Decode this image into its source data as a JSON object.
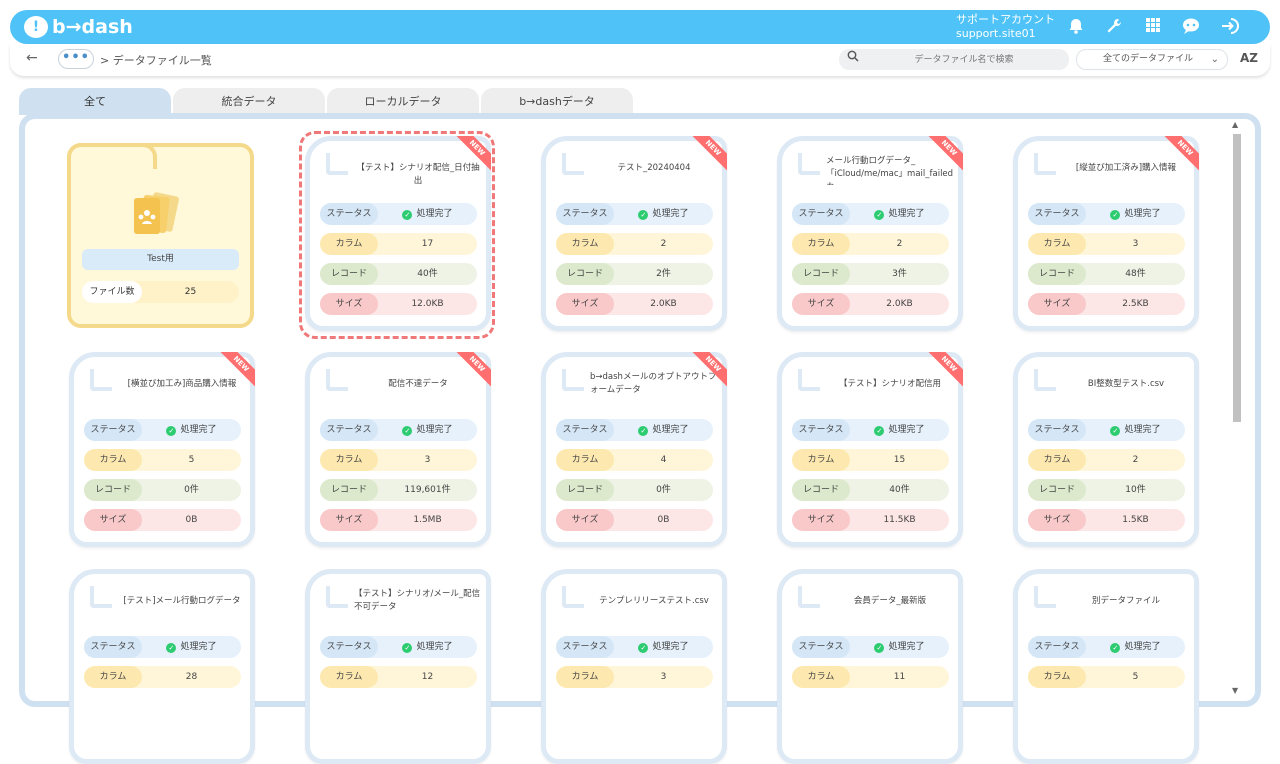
{
  "header": {
    "logo_text": "b→dash",
    "account_line1": "サポートアカウント",
    "account_line2": "support.site01",
    "icons": [
      "bell-icon",
      "wrench-icon",
      "grid-icon",
      "chat-bot-icon",
      "logout-icon"
    ]
  },
  "subbar": {
    "back": "←",
    "more": "•••",
    "breadcrumb": "> データファイル一覧",
    "search_placeholder": "データファイル名で検索",
    "filter_value": "全てのデータファイル",
    "sort_label": "AZ"
  },
  "tabs": [
    {
      "label": "全て",
      "active": true
    },
    {
      "label": "統合データ",
      "active": false
    },
    {
      "label": "ローカルデータ",
      "active": false
    },
    {
      "label": "b→dashデータ",
      "active": false
    }
  ],
  "labels": {
    "status": "ステータス",
    "column": "カラム",
    "record": "レコード",
    "size": "サイズ",
    "done": "処理完了",
    "new": "NEW",
    "file_count": "ファイル数"
  },
  "folder": {
    "name": "Test用",
    "file_count": "25"
  },
  "cards": [
    {
      "title": "【テスト】シナリオ配信_日付抽出",
      "column": "17",
      "record": "40件",
      "size": "12.0KB",
      "is_new": true,
      "selected": true
    },
    {
      "title": "テスト_20240404",
      "column": "2",
      "record": "2件",
      "size": "2.0KB",
      "is_new": true
    },
    {
      "title": "メール行動ログデータ_「iCloud/me/mac」mail_failedカ…",
      "column": "2",
      "record": "3件",
      "size": "2.0KB",
      "is_new": true
    },
    {
      "title": "[縦並び加工済み]購入情報",
      "column": "3",
      "record": "48件",
      "size": "2.5KB",
      "is_new": true
    },
    {
      "title": "[横並び加工み]商品購入情報",
      "column": "5",
      "record": "0件",
      "size": "0B",
      "is_new": true
    },
    {
      "title": "配信不達データ",
      "column": "3",
      "record": "119,601件",
      "size": "1.5MB",
      "is_new": true
    },
    {
      "title": "b→dashメールのオプトアウトフォームデータ",
      "column": "4",
      "record": "0件",
      "size": "0B",
      "is_new": true
    },
    {
      "title": "【テスト】シナリオ配信用",
      "column": "15",
      "record": "40件",
      "size": "11.5KB",
      "is_new": true
    },
    {
      "title": "BI整数型テスト.csv",
      "column": "2",
      "record": "10件",
      "size": "1.5KB",
      "is_new": false
    },
    {
      "title": "[テスト]メール行動ログデータ",
      "column": "28",
      "is_new": false
    },
    {
      "title": "【テスト】シナリオ/メール_配信不可データ",
      "column": "12",
      "is_new": false
    },
    {
      "title": "テンプレリリーステスト.csv",
      "column": "3",
      "is_new": false
    },
    {
      "title": "会員データ_最新版",
      "column": "11",
      "is_new": false
    },
    {
      "title": "別データファイル",
      "column": "5",
      "is_new": false
    }
  ],
  "colors": {
    "brand": "#4fc3f7",
    "new_ribbon": "#ff6f6f",
    "done_check": "#2ecc71",
    "selected_outline": "#f07878"
  }
}
